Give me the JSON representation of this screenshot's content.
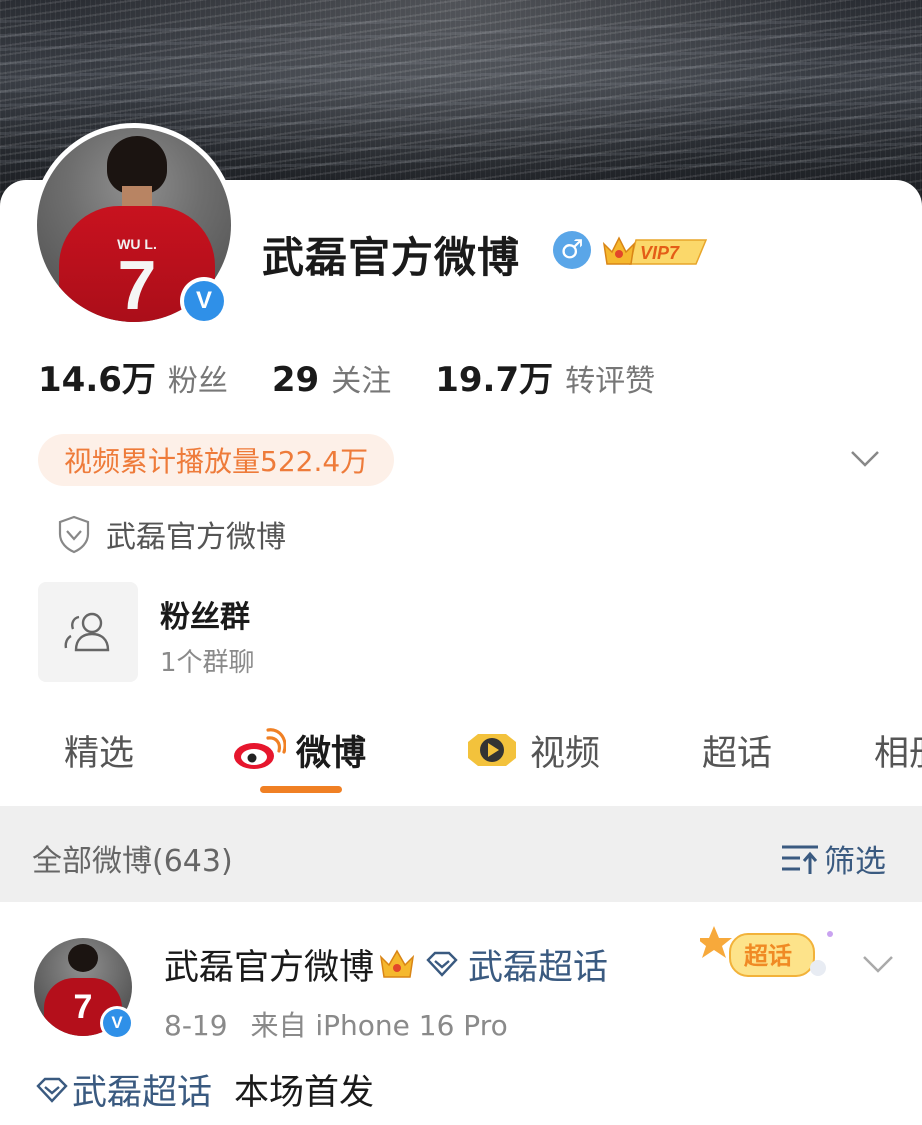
{
  "profile": {
    "name": "武磊官方微博",
    "gender_symbol": "♂",
    "vip_label": "VIP7",
    "jersey_name": "WU L.",
    "jersey_number": "7",
    "verified_mark": "V"
  },
  "stats": [
    {
      "value": "14.6万",
      "label": "粉丝"
    },
    {
      "value": "29",
      "label": "关注"
    },
    {
      "value": "19.7万",
      "label": "转评赞"
    }
  ],
  "video_play_count": "视频累计播放量522.4万",
  "verification_text": "武磊官方微博",
  "fan_group": {
    "title": "粉丝群",
    "subtitle": "1个群聊"
  },
  "tabs": [
    {
      "label": "精选",
      "icon": ""
    },
    {
      "label": "微博",
      "icon": "weibo-logo-icon"
    },
    {
      "label": "视频",
      "icon": "video-play-icon"
    },
    {
      "label": "超话",
      "icon": ""
    },
    {
      "label": "相册",
      "icon": ""
    }
  ],
  "active_tab": "微博",
  "filter_bar": {
    "all_posts": "全部微博(643)",
    "filter_label": "筛选"
  },
  "post": {
    "author": "武磊官方微博",
    "topic_link": "武磊超话",
    "badge_label": "超话",
    "date": "8-19",
    "source": "来自 iPhone 16 Pro",
    "body_topic": "武磊超话",
    "body_text": "本场首发"
  },
  "colors": {
    "accent_orange": "#f08024",
    "link_blue": "#3a5a80",
    "verified_blue": "#2f90e8",
    "pill_text": "#ee7b3a",
    "pill_bg": "#fdf0e8"
  }
}
